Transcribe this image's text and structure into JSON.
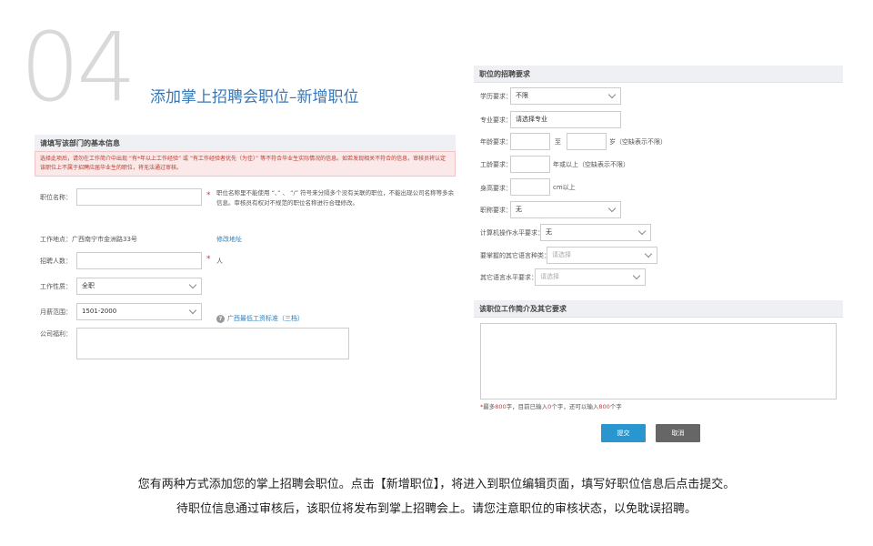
{
  "hero": {
    "number": "04",
    "title": "添加掌上招聘会职位–新增职位"
  },
  "left": {
    "section_title": "请填写该部门的基本信息",
    "warning": "选择此项后，请勿在工作简介中出现 “有*年以上工作经验” 或 “有工作经验者优先（为佳）” 等不符合毕业生实际情况的信息。如若发现相关不符合的信息，审核员将认定该职位上不属于招聘应届毕业生的职位，将无法通过审核。",
    "job_name_label": "职位名称：",
    "job_name_value": "",
    "job_name_req": "*",
    "job_name_note": "职位名称里不能使用 “、” 、 “/” 符号来分隔多个没有关联的职位，不能出现公司名称等多余信息。审核员有权对不规范的职位名称进行合理修改。",
    "location_text": "工作地点：广西南宁市金洲路33号",
    "modify_address": "修改地址",
    "headcount_label": "招聘人数：",
    "headcount_value": "",
    "headcount_req": "*",
    "headcount_unit": "人",
    "nature_label": "工作性质：",
    "nature_value": "全职",
    "salary_label": "月薪范围：",
    "salary_value": "1501-2000",
    "help_glyph": "?",
    "salary_link": "广西最低工资标准（三档）",
    "welfare_label": "公司福利：",
    "welfare_value": ""
  },
  "right": {
    "section_title": "职位的招聘要求",
    "education_label": "学历要求：",
    "education_value": "不限",
    "major_label": "专业要求：",
    "major_value": "请选择专业",
    "age_label": "年龄要求：",
    "age_to": "至",
    "age_unit": "岁（空缺表示不限）",
    "work_label": "工龄要求：",
    "work_unit": "年或以上（空缺表示不限）",
    "height_label": "身高要求：",
    "height_unit": "cm以上",
    "title_label": "职称要求：",
    "title_value": "无",
    "computer_label": "计算机操作水平要求：",
    "computer_value": "无",
    "language_label": "要掌握的其它语言种类：",
    "language_placeholder": "请选择",
    "lang_level_label": "其它语言水平要求：",
    "lang_level_placeholder": "请选择",
    "intro_title": "该职位工作简介及其它要求",
    "intro_value": "",
    "counter": {
      "star": "*",
      "p1": "最多",
      "max": "800",
      "p2": "字，目前已输入",
      "current": "0",
      "p3": "个字，还可以输入",
      "remain": "800",
      "p4": "个字"
    },
    "submit": "提交",
    "cancel": "取消"
  },
  "caption": {
    "line1": "您有两种方式添加您的掌上招聘会职位。点击【新增职位】，将进入到职位编辑页面，填写好职位信息后点击提交。",
    "line2": "待职位信息通过审核后，该职位将发布到掌上招聘会上。请您注意职位的审核状态，以免耽误招聘。"
  },
  "colors": {
    "submit": "#2a96d0",
    "cancel": "#666666",
    "title": "#3a78b5",
    "warning_bg": "#fbe8e8"
  }
}
